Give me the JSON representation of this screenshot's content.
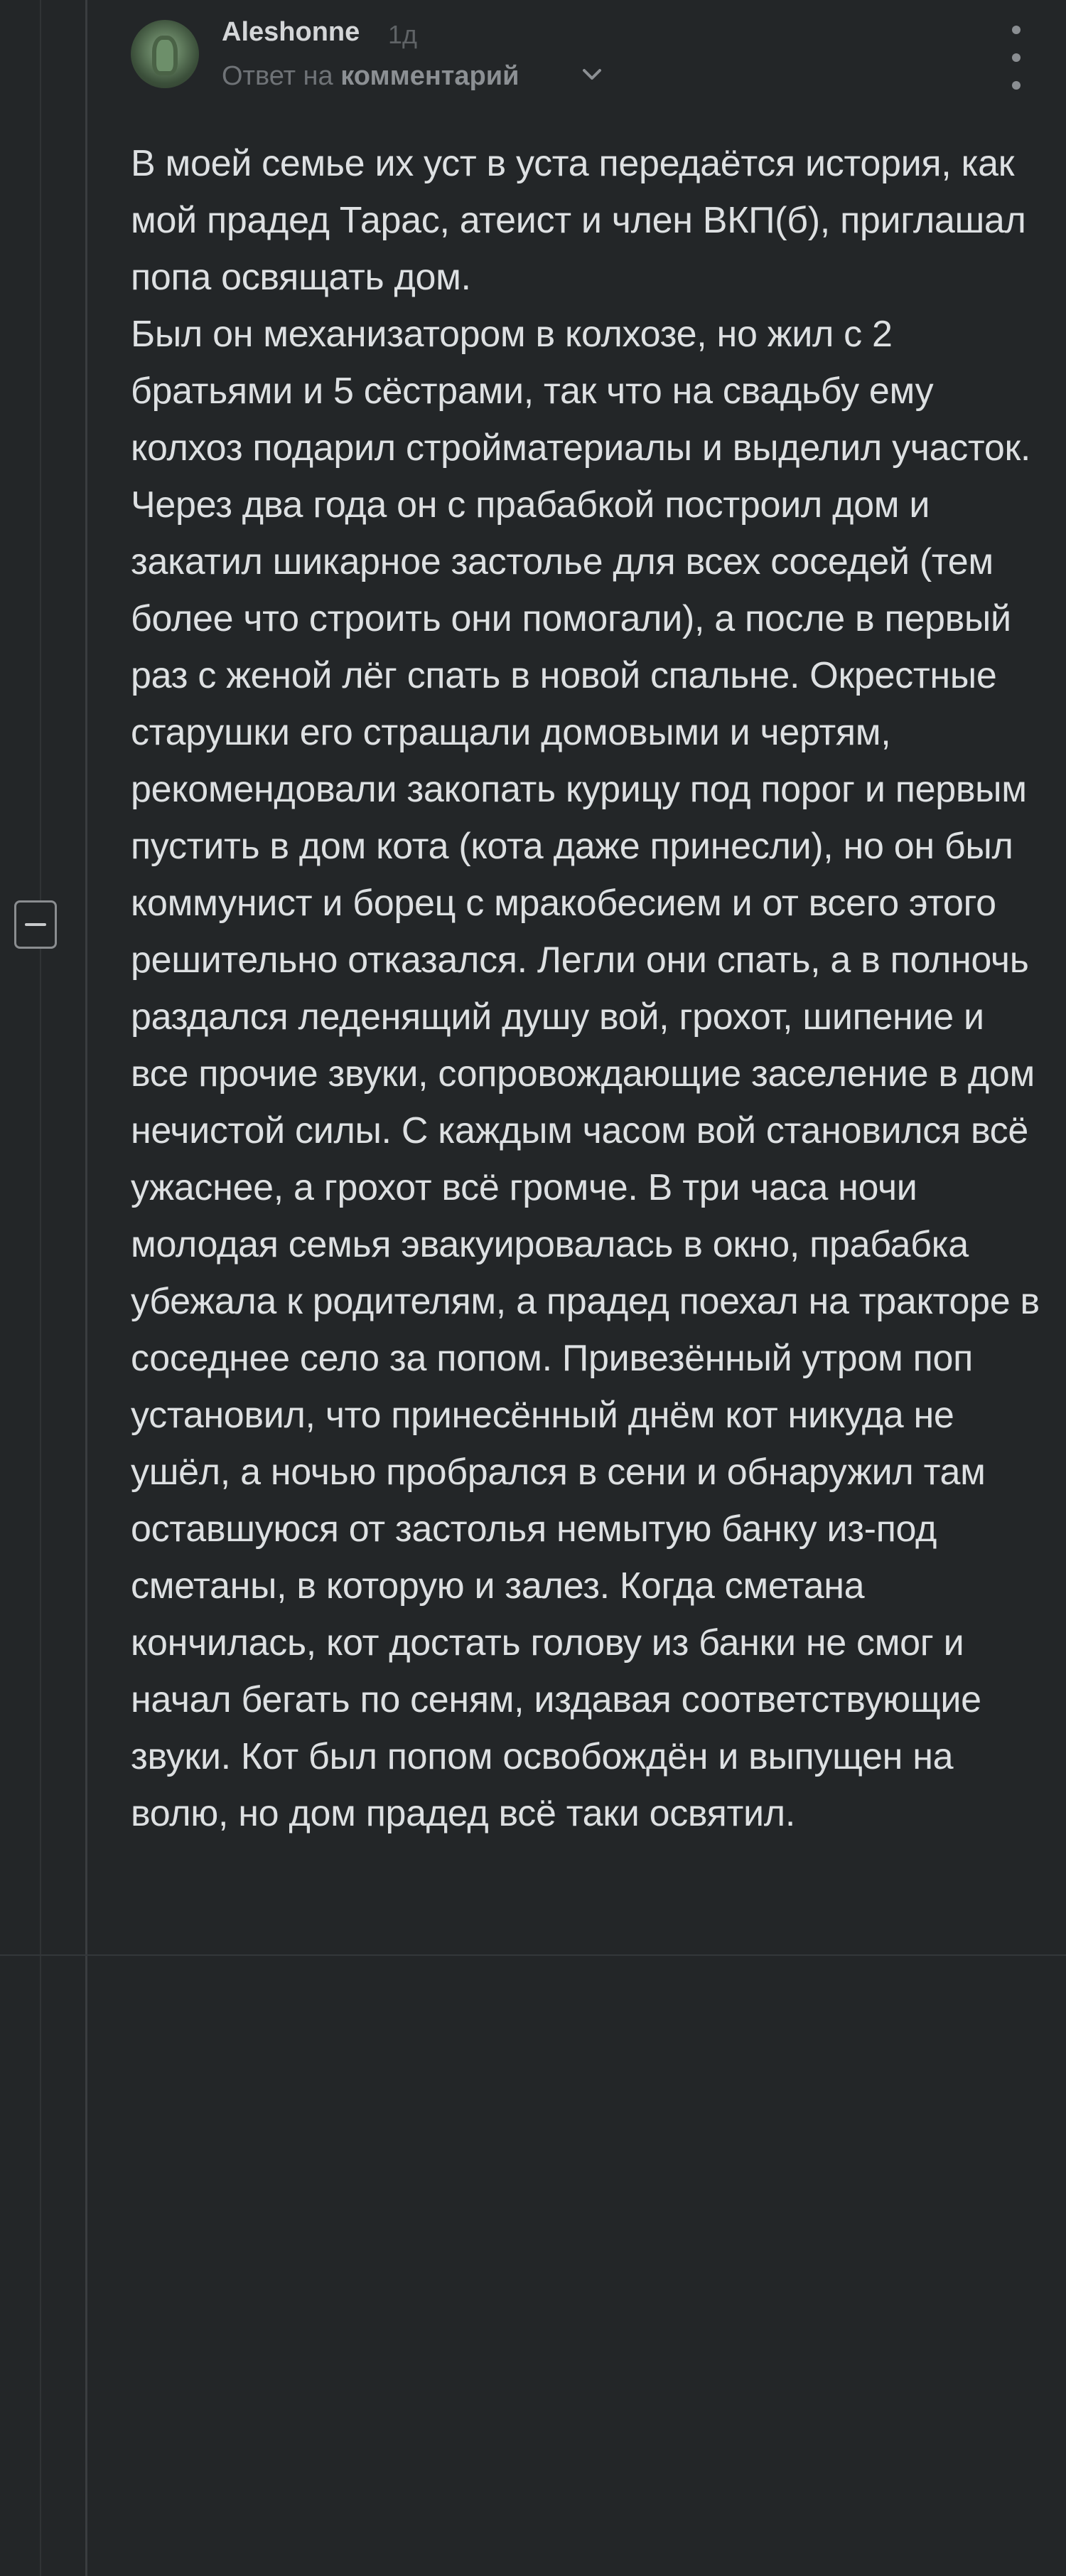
{
  "comment": {
    "author": "Aleshonne",
    "time": "1д",
    "reply_prefix": "Ответ на",
    "reply_target": "комментарий",
    "avatar_icon": "avatar-image",
    "menu_icon": "more-vertical-icon",
    "collapse_icon": "minus-square-icon",
    "paragraphs": [
      "В моей семье их уст в уста передаётся история, как мой прадед Тарас, атеист и член ВКП(б), приглашал попа освящать дом.",
      "Был он механизатором в колхозе, но жил с 2 братьями и 5 сёстрами, так что на свадьбу ему колхоз подарил стройматериалы и выделил участок. Через два года он с прабабкой построил дом и закатил шикарное застолье для всех соседей (тем более что строить они помогали), а после в первый раз с женой лёг спать в новой спальне. Окрестные старушки его стращали домовыми и чертям, рекомендовали закопать курицу под порог и первым пустить в дом кота (кота даже принесли), но он был коммунист и борец с мракобесием и от всего этого решительно отказался. Легли они спать, а в полночь раздался леденящий душу вой, грохот, шипение и все прочие звуки, сопровождающие заселение в дом нечистой силы. С каждым часом вой становился всё ужаснее, а грохот всё громче. В три часа ночи молодая семья эвакуировалась в окно, прабабка убежала к родителям, а прадед поехал на тракторе в соседнее село за попом. Привезённый утром поп установил, что принесённый днём кот никуда не ушёл, а ночью пробрался в сени и обнаружил там оставшуюся от застолья немытую банку из-под сметаны, в которую и залез. Когда сметана кончилась, кот достать голову из банки не смог и начал бегать по сеням, издавая соответствующие звуки. Кот был попом освобождён и выпущен на волю, но дом прадед всё таки освятил."
    ]
  }
}
